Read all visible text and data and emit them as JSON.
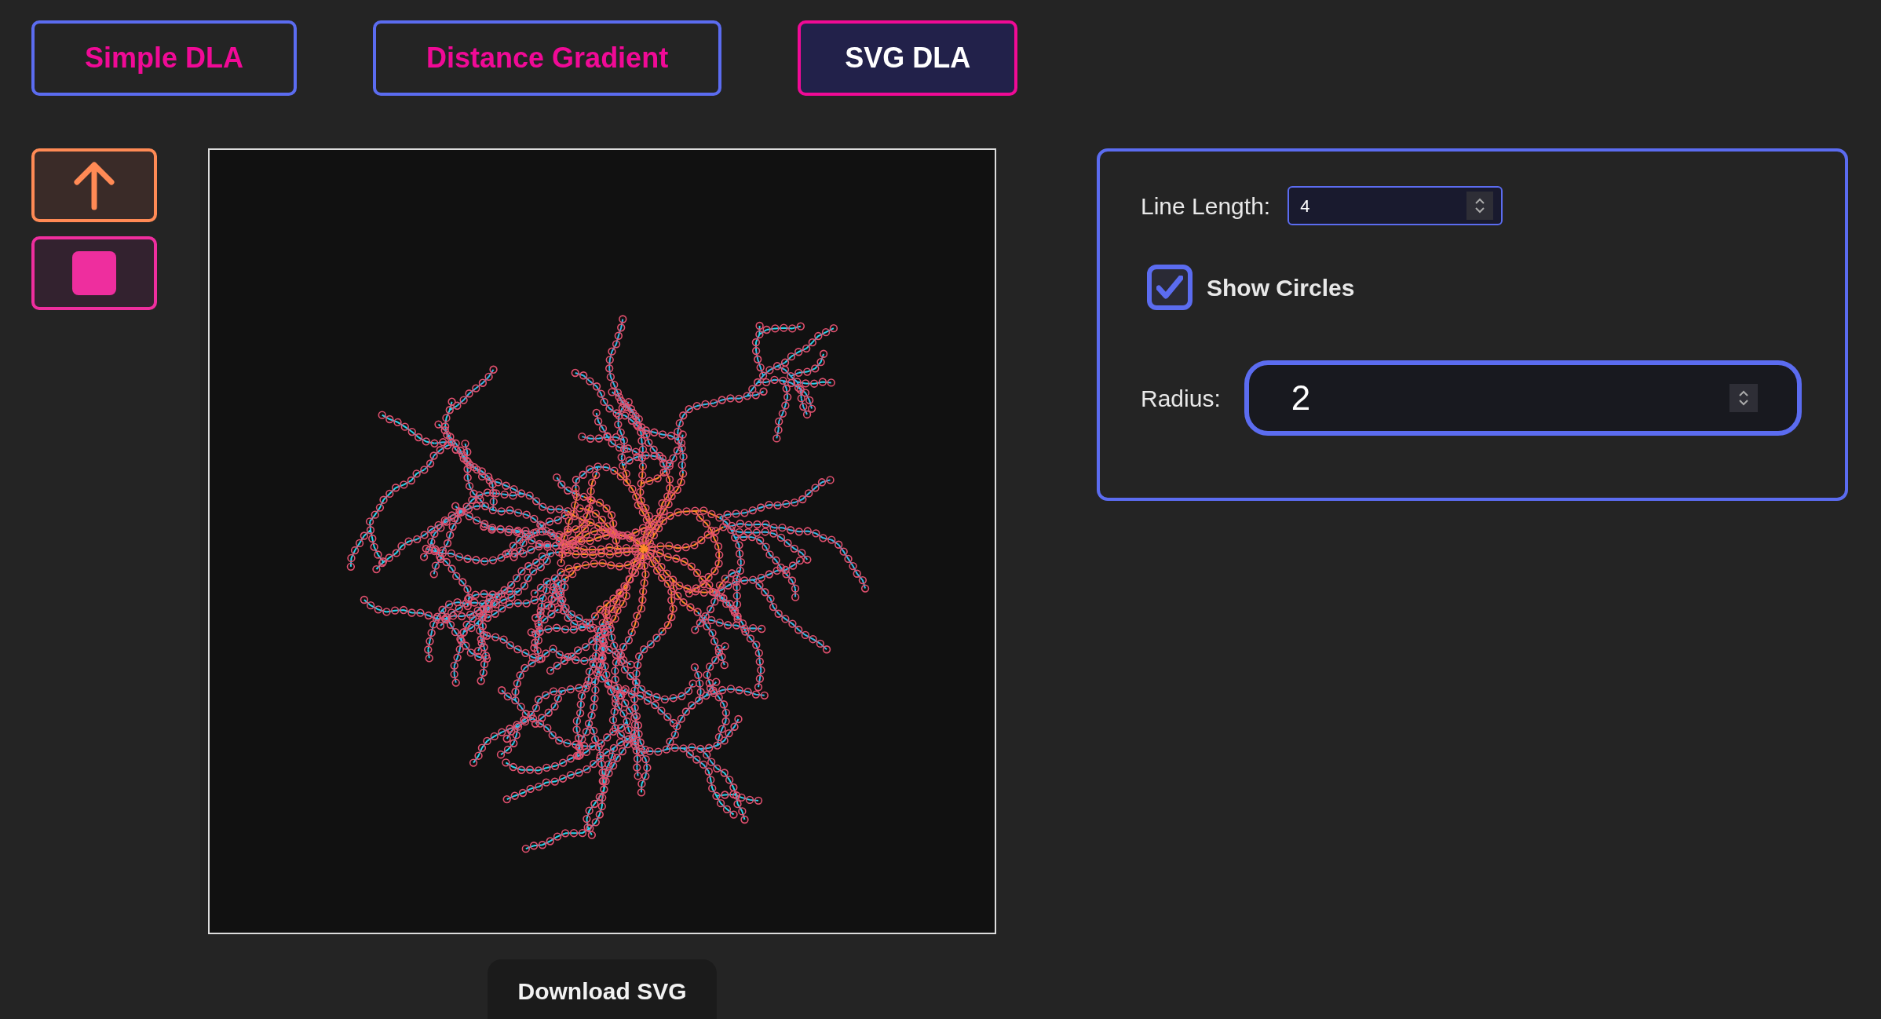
{
  "tabs": [
    {
      "label": "Simple DLA",
      "selected": false
    },
    {
      "label": "Distance Gradient",
      "selected": false
    },
    {
      "label": "SVG DLA",
      "selected": true
    }
  ],
  "settings": {
    "line_length": {
      "label": "Line Length:",
      "value": "4"
    },
    "show_circles": {
      "label": "Show Circles",
      "checked": true
    },
    "radius": {
      "label": "Radius:",
      "value": "2"
    }
  },
  "download_button": "Download SVG"
}
